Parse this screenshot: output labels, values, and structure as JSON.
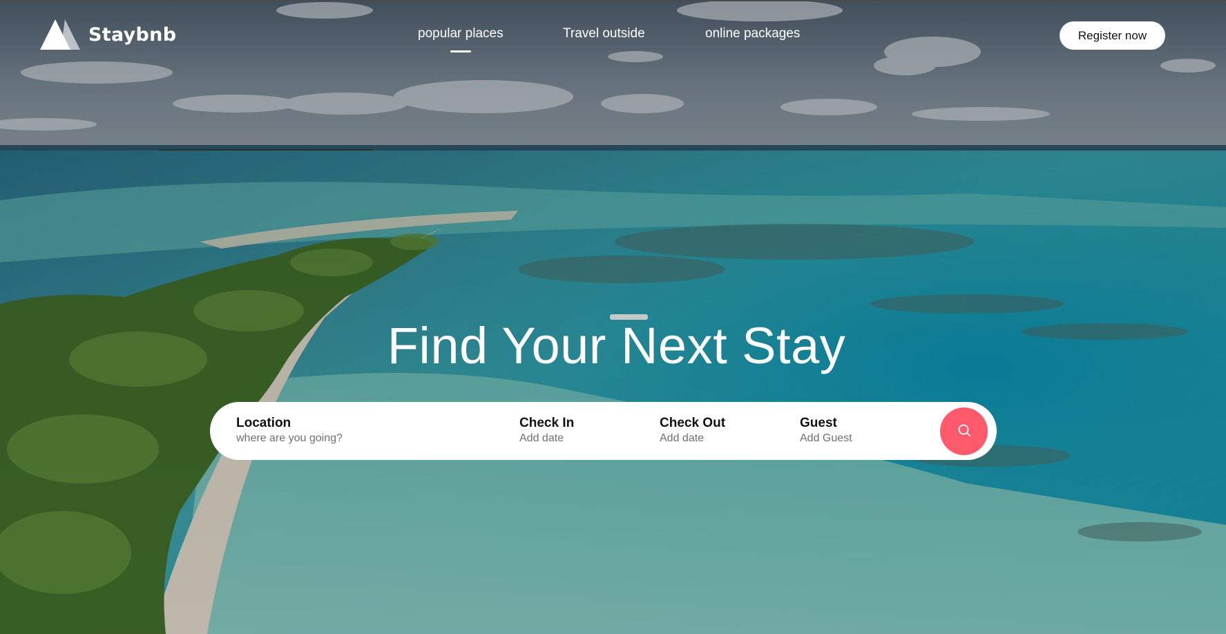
{
  "brand": {
    "name": "Staybnb"
  },
  "nav": {
    "items": [
      {
        "label": "popular places",
        "active": true
      },
      {
        "label": "Travel outside",
        "active": false
      },
      {
        "label": "online packages",
        "active": false
      }
    ]
  },
  "header": {
    "register_label": "Register now"
  },
  "hero": {
    "headline": "Find Your Next Stay"
  },
  "search": {
    "location": {
      "label": "Location",
      "placeholder": "where are you going?"
    },
    "check_in": {
      "label": "Check In",
      "placeholder": "Add date"
    },
    "check_out": {
      "label": "Check Out",
      "placeholder": "Add date"
    },
    "guest": {
      "label": "Guest",
      "placeholder": "Add Guest"
    },
    "button_icon": "search-icon"
  },
  "colors": {
    "accent": "#ff5a6b",
    "text_light": "#ffffff",
    "text_dark": "#111111",
    "muted": "#6f6f6f"
  }
}
